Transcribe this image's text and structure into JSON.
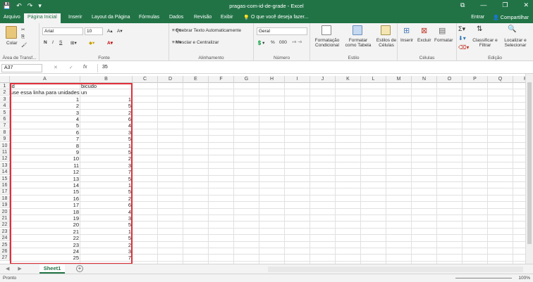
{
  "window": {
    "title": "pragas-com-id-de-grade - Excel",
    "qat": [
      "💾",
      "↶",
      "↷",
      "▾"
    ],
    "controls": [
      "⧉",
      "—",
      "❐",
      "✕"
    ]
  },
  "tabs": [
    "Arquivo",
    "Página Inicial",
    "Inserir",
    "Layout da Página",
    "Fórmulas",
    "Dados",
    "Revisão",
    "Exibir"
  ],
  "tell_me": "O que você deseja fazer...",
  "account": {
    "signin": "Entrar",
    "share": "Compartilhar"
  },
  "ribbon": {
    "clipboard": {
      "paste": "Colar",
      "label": "Área de Transf..."
    },
    "font": {
      "name": "Arial",
      "size": "10",
      "bold": "N",
      "italic": "I",
      "underline": "S",
      "label": "Fonte"
    },
    "alignment": {
      "wrap": "Quebrar Texto Automaticamente",
      "merge": "Mesclar e Centralizar",
      "label": "Alinhamento"
    },
    "number": {
      "format": "Geral",
      "label": "Número",
      "percent": "%",
      "thousands": "000"
    },
    "styles": {
      "conditional": "Formatação Condicional",
      "as_table": "Formatar como Tabela",
      "cell_styles": "Estilos de Células",
      "label": "Estilo"
    },
    "cells": {
      "insert": "Inserir",
      "delete": "Excluir",
      "format": "Formatar",
      "label": "Células"
    },
    "editing": {
      "sort": "Classificar e Filtrar",
      "find": "Localizar e Selecionar",
      "label": "Edição"
    }
  },
  "formula_bar": {
    "name_box": "A37",
    "fx": "fx",
    "value": "35",
    "cancel": "✕",
    "enter": "✓"
  },
  "columns": [
    "A",
    "B",
    "C",
    "D",
    "E",
    "F",
    "G",
    "H",
    "I",
    "J",
    "K",
    "L",
    "M",
    "N",
    "O",
    "P",
    "Q",
    "R"
  ],
  "rows": [
    {
      "n": "1",
      "a": "id",
      "b": "bicudo"
    },
    {
      "n": "2",
      "a": "use essa linha para unidades",
      "b": "un"
    },
    {
      "n": "3",
      "a": "1",
      "b": "1"
    },
    {
      "n": "4",
      "a": "2",
      "b": "5"
    },
    {
      "n": "5",
      "a": "3",
      "b": "2"
    },
    {
      "n": "6",
      "a": "4",
      "b": "6"
    },
    {
      "n": "7",
      "a": "5",
      "b": "4"
    },
    {
      "n": "8",
      "a": "6",
      "b": "3"
    },
    {
      "n": "9",
      "a": "7",
      "b": "5"
    },
    {
      "n": "10",
      "a": "8",
      "b": "1"
    },
    {
      "n": "11",
      "a": "9",
      "b": "5"
    },
    {
      "n": "12",
      "a": "10",
      "b": "2"
    },
    {
      "n": "13",
      "a": "11",
      "b": "3"
    },
    {
      "n": "14",
      "a": "12",
      "b": "7"
    },
    {
      "n": "15",
      "a": "13",
      "b": "5"
    },
    {
      "n": "16",
      "a": "14",
      "b": "1"
    },
    {
      "n": "17",
      "a": "15",
      "b": "5"
    },
    {
      "n": "18",
      "a": "16",
      "b": "2"
    },
    {
      "n": "19",
      "a": "17",
      "b": "6"
    },
    {
      "n": "20",
      "a": "18",
      "b": "4"
    },
    {
      "n": "21",
      "a": "19",
      "b": "3"
    },
    {
      "n": "22",
      "a": "20",
      "b": "5"
    },
    {
      "n": "23",
      "a": "21",
      "b": "1"
    },
    {
      "n": "24",
      "a": "22",
      "b": "5"
    },
    {
      "n": "25",
      "a": "23",
      "b": "2"
    },
    {
      "n": "26",
      "a": "24",
      "b": "3"
    },
    {
      "n": "27",
      "a": "25",
      "b": "7"
    }
  ],
  "sheet_tab": "Sheet1",
  "status": {
    "ready": "Pronto",
    "zoom": "100%"
  },
  "colors": {
    "excel_green": "#217346",
    "selection_red": "#e0303a"
  }
}
